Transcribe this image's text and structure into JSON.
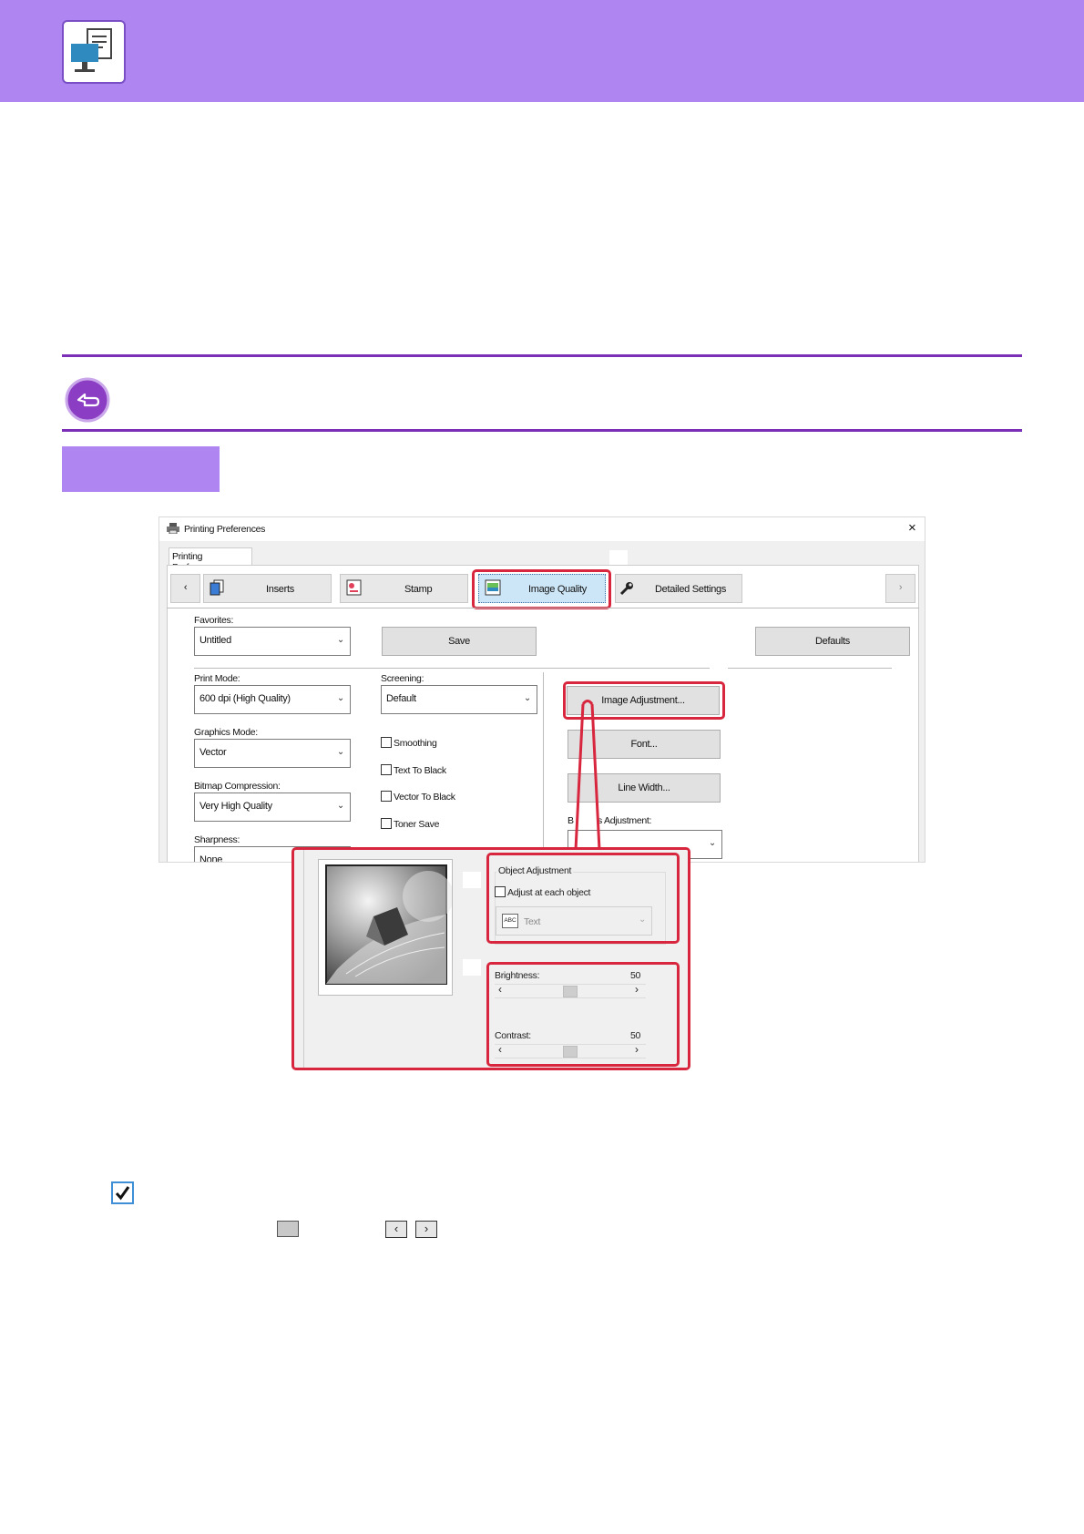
{
  "colors": {
    "accent": "#ae85f1",
    "rule": "#7a2fb6",
    "highlight": "#d7263d"
  },
  "icons": {
    "header": "printer-document-icon",
    "return": "return-arrow-icon",
    "check": "checkbox-checked-icon"
  },
  "dialog": {
    "title": "Printing Preferences",
    "close_label": "×",
    "tab_group_label": "Printing Preferences",
    "nav_prev": "‹",
    "nav_next": "›",
    "tabs": [
      {
        "label": "Inserts"
      },
      {
        "label": "Stamp"
      },
      {
        "label": "Image Quality"
      },
      {
        "label": "Detailed Settings"
      }
    ],
    "favorites": {
      "label": "Favorites:",
      "value": "Untitled",
      "save": "Save",
      "defaults": "Defaults"
    },
    "print_mode": {
      "label": "Print Mode:",
      "value": "600 dpi (High Quality)"
    },
    "graphics_mode": {
      "label": "Graphics Mode:",
      "value": "Vector"
    },
    "bitmap_compression": {
      "label": "Bitmap Compression:",
      "value": "Very High Quality"
    },
    "sharpness": {
      "label": "Sharpness:",
      "value": "None"
    },
    "screening": {
      "label": "Screening:",
      "value": "Default"
    },
    "checkboxes": [
      {
        "label": "Smoothing"
      },
      {
        "label": "Text To Black"
      },
      {
        "label": "Vector To Black"
      },
      {
        "label": "Toner Save"
      }
    ],
    "buttons": {
      "image_adjustment": "Image Adjustment...",
      "font": "Font...",
      "line_width": "Line Width..."
    },
    "bitmap_adjustment_label_start": "B",
    "bitmap_adjustment_label_end": "s Adjustment:"
  },
  "zoom": {
    "object_adjustment": {
      "title": "Object Adjustment",
      "checkbox_label": "Adjust at each object",
      "select_badge": "ABC",
      "select_value": "Text"
    },
    "brightness": {
      "label": "Brightness:",
      "value": "50",
      "level": 0.5
    },
    "contrast": {
      "label": "Contrast:",
      "value": "50",
      "level": 0.5
    },
    "arrow_left": "‹",
    "arrow_right": "›"
  },
  "legend": {
    "left_key": "‹",
    "right_key": "›"
  }
}
